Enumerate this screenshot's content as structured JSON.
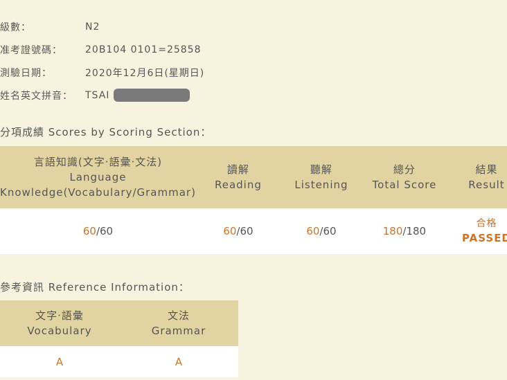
{
  "info": [
    {
      "label": "級數：",
      "value": "N2"
    },
    {
      "label": "准考證號碼：",
      "value": "20B104 0101=25858"
    },
    {
      "label": "測驗日期：",
      "value": "2020年12月6日(星期日)"
    },
    {
      "label": "姓名英文拼音：",
      "value": "TSAI",
      "redacted": true
    }
  ],
  "scores_section": {
    "title": "分項成績 Scores by Scoring Section：",
    "headers": [
      {
        "zh": "言語知識(文字‧語彙‧文法)",
        "en1": "Language",
        "en2": "Knowledge(Vocabulary/Grammar)"
      },
      {
        "zh": "讀解",
        "en1": "Reading"
      },
      {
        "zh": "聽解",
        "en1": "Listening"
      },
      {
        "zh": "總分",
        "en1": "Total Score"
      },
      {
        "zh": "結果",
        "en1": "Result"
      }
    ],
    "row": [
      {
        "score": "60",
        "max": "/60"
      },
      {
        "score": "60",
        "max": "/60"
      },
      {
        "score": "60",
        "max": "/60"
      },
      {
        "score": "180",
        "max": "/180"
      }
    ],
    "result": {
      "zh": "合格",
      "en": "PASSED"
    }
  },
  "reference_section": {
    "title": "參考資訊 Reference Information：",
    "headers": [
      {
        "zh": "文字‧語彙",
        "en": "Vocabulary"
      },
      {
        "zh": "文法",
        "en": "Grammar"
      }
    ],
    "row": [
      "A",
      "A"
    ]
  },
  "colors": {
    "background": "#f7f3de",
    "header": "#e2d4a2",
    "accent": "#c8742a"
  }
}
